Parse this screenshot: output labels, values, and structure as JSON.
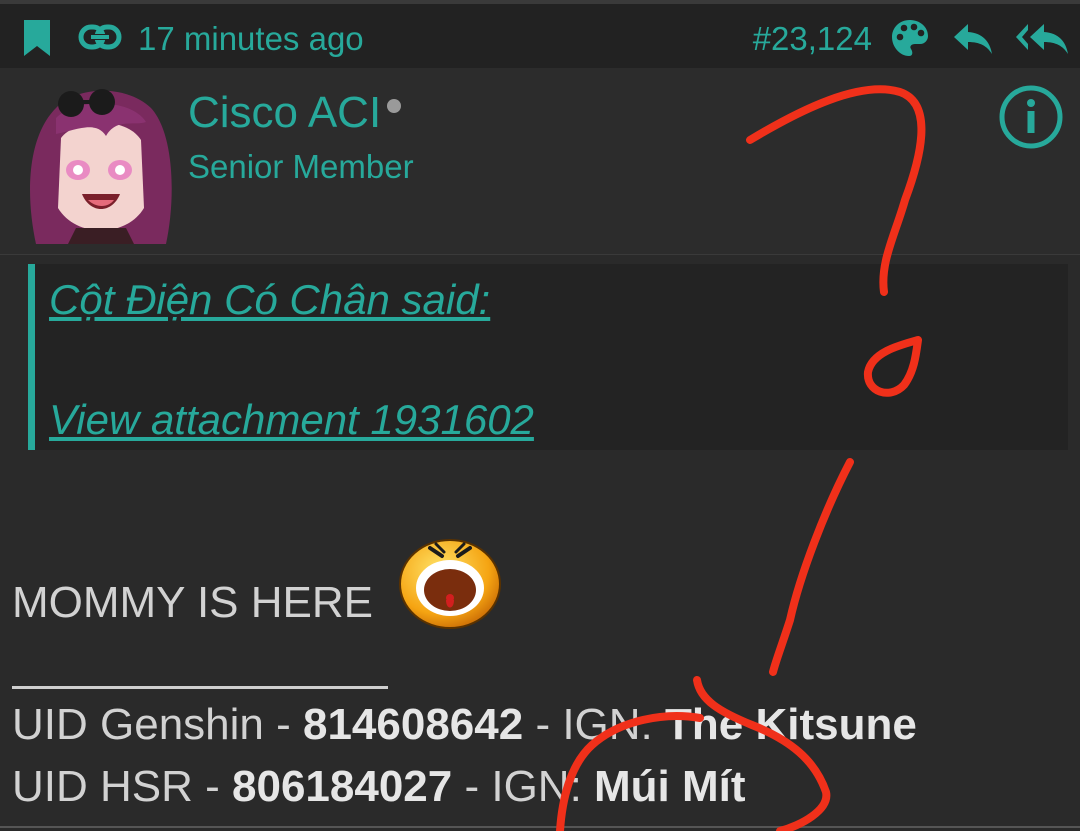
{
  "header": {
    "time": "17 minutes ago",
    "post_number": "#23,124"
  },
  "user": {
    "name": "Cisco ACI",
    "title": "Senior Member"
  },
  "quote": {
    "author_link": "Cột Điện Có Chân said:",
    "attachment_link": "View attachment 1931602"
  },
  "post": {
    "message": "MOMMY IS HERE",
    "sig_line1_label": "UID Genshin - ",
    "sig_line1_uid": "814608642",
    "sig_line1_sep": " - IGN: ",
    "sig_line1_ign": "The Kitsune",
    "sig_line2_label": "UID HSR - ",
    "sig_line2_uid": "806184027",
    "sig_line2_sep": " - IGN: ",
    "sig_line2_ign": "Múi Mít"
  },
  "colors": {
    "accent": "#27a99b",
    "annotation": "#f0301a"
  }
}
